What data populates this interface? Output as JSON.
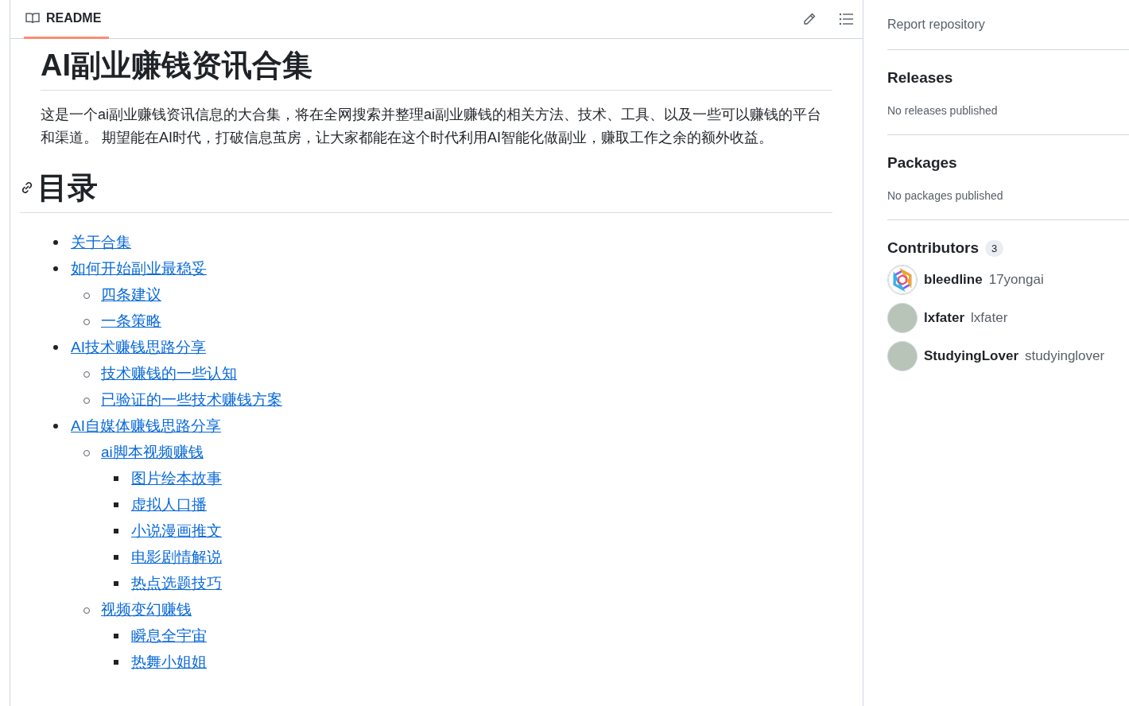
{
  "readme": {
    "tab": "README",
    "title": "AI副业赚钱资讯合集",
    "intro": "这是一个ai副业赚钱资讯信息的大合集，将在全网搜索并整理ai副业赚钱的相关方法、技术、工具、以及一些可以赚钱的平台和渠道。 期望能在AI时代，打破信息茧房，让大家都能在这个时代利用AI智能化做副业，赚取工作之余的额外收益。",
    "toc_heading": "目录",
    "toc": [
      {
        "label": "关于合集"
      },
      {
        "label": "如何开始副业最稳妥",
        "children": [
          {
            "label": "四条建议"
          },
          {
            "label": "一条策略"
          }
        ]
      },
      {
        "label": "AI技术赚钱思路分享",
        "children": [
          {
            "label": "技术赚钱的一些认知"
          },
          {
            "label": "已验证的一些技术赚钱方案"
          }
        ]
      },
      {
        "label": "AI自媒体赚钱思路分享",
        "children": [
          {
            "label": "ai脚本视频赚钱",
            "children": [
              {
                "label": "图片绘本故事"
              },
              {
                "label": "虚拟人口播"
              },
              {
                "label": "小说漫画推文"
              },
              {
                "label": "电影剧情解说"
              },
              {
                "label": "热点选题技巧"
              }
            ]
          },
          {
            "label": "视频变幻赚钱",
            "children": [
              {
                "label": "瞬息全宇宙"
              },
              {
                "label": "热舞小姐姐"
              }
            ]
          }
        ]
      }
    ]
  },
  "sidebar": {
    "report": "Report repository",
    "sections": [
      {
        "title": "Releases",
        "text": "No releases published"
      },
      {
        "title": "Packages",
        "text": "No packages published"
      }
    ],
    "contributors": {
      "title": "Contributors",
      "count": "3",
      "people": [
        {
          "name": "bleedline",
          "login": "17yongai",
          "kind": "logo"
        },
        {
          "name": "lxfater",
          "login": "lxfater",
          "kind": "photo"
        },
        {
          "name": "StudyingLover",
          "login": "studyinglover",
          "kind": "photo"
        }
      ]
    }
  }
}
